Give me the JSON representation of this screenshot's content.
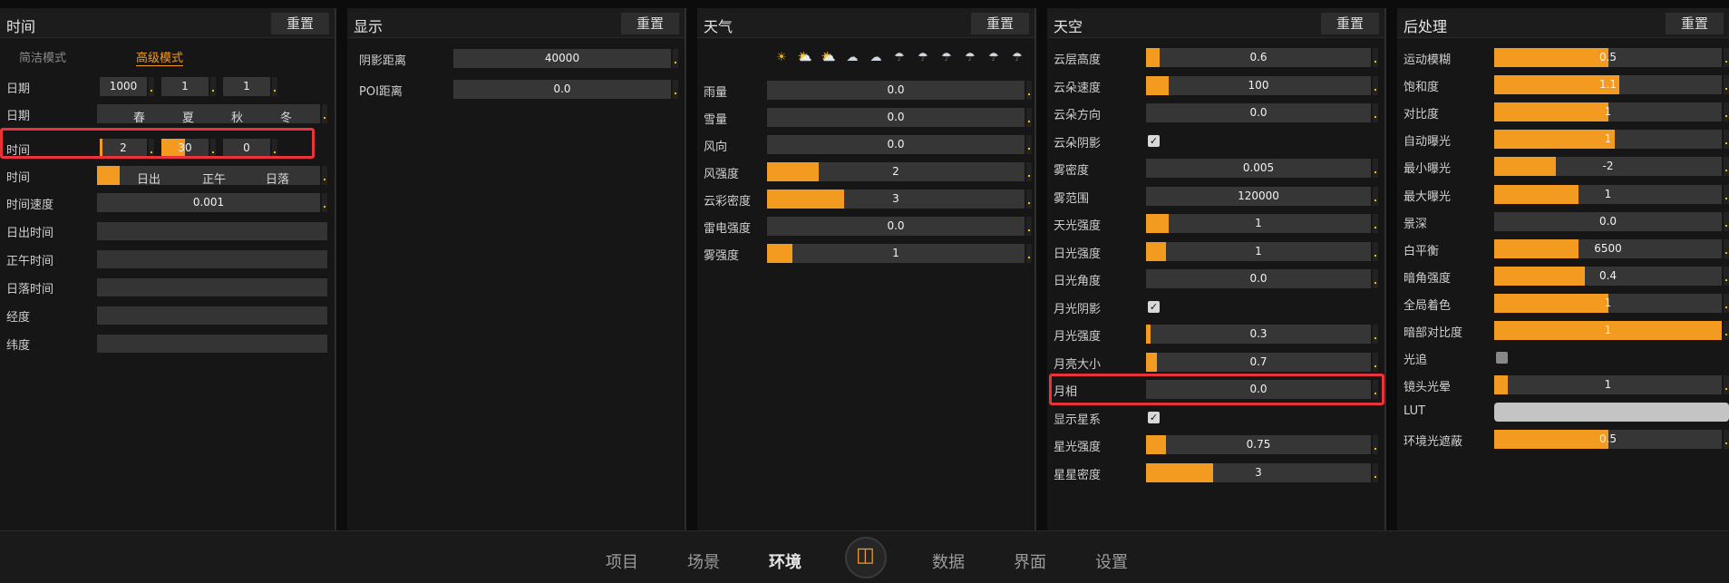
{
  "reset_label": "重置",
  "time_panel": {
    "title": "时间",
    "mode_simple": "简洁模式",
    "mode_advanced": "高级模式",
    "date_label": "日期",
    "date_year": "1000",
    "date_month": "1",
    "date_day": "1",
    "season_label": "日期",
    "seasons": [
      "春",
      "夏",
      "秋",
      "冬"
    ],
    "time_label": "时间",
    "time_hour": "2",
    "time_minute": "30",
    "time_second": "0",
    "time_fill_hour": 0.05,
    "time_fill_minute": 0.5,
    "preset_label": "时间",
    "presets": [
      "日出",
      "正午",
      "日落"
    ],
    "speed_label": "时间速度",
    "speed_value": "0.001",
    "sunrise_label": "日出时间",
    "noon_label": "正午时间",
    "sunset_label": "日落时间",
    "longitude_label": "经度",
    "latitude_label": "纬度"
  },
  "display_panel": {
    "title": "显示",
    "shadow_label": "阴影距离",
    "shadow_value": "40000",
    "poi_label": "POI距离",
    "poi_value": "0.0"
  },
  "weather_panel": {
    "title": "天气",
    "icons": [
      "☀",
      "⛅",
      "⛅",
      "☁",
      "☁",
      "☂",
      "☂",
      "☂",
      "☂",
      "☂",
      "☂"
    ],
    "rows": [
      {
        "label": "雨量",
        "value": "0.0",
        "fill": 0
      },
      {
        "label": "雪量",
        "value": "0.0",
        "fill": 0
      },
      {
        "label": "风向",
        "value": "0.0",
        "fill": 0
      },
      {
        "label": "风强度",
        "value": "2",
        "fill": 0.2
      },
      {
        "label": "云彩密度",
        "value": "3",
        "fill": 0.3
      },
      {
        "label": "雷电强度",
        "value": "0.0",
        "fill": 0
      },
      {
        "label": "雾强度",
        "value": "1",
        "fill": 0.1
      }
    ]
  },
  "sky_panel": {
    "title": "天空",
    "rows": [
      {
        "label": "云层高度",
        "type": "bar",
        "value": "0.6",
        "fill": 0.06
      },
      {
        "label": "云朵速度",
        "type": "bar",
        "value": "100",
        "fill": 0.1
      },
      {
        "label": "云朵方向",
        "type": "bar",
        "value": "0.0",
        "fill": 0
      },
      {
        "label": "云朵阴影",
        "type": "check",
        "checked": true
      },
      {
        "label": "雾密度",
        "type": "bar",
        "value": "0.005",
        "fill": 0
      },
      {
        "label": "雾范围",
        "type": "bar",
        "value": "120000",
        "fill": 0
      },
      {
        "label": "天光强度",
        "type": "bar",
        "value": "1",
        "fill": 0.1
      },
      {
        "label": "日光强度",
        "type": "bar",
        "value": "1",
        "fill": 0.09
      },
      {
        "label": "日光角度",
        "type": "bar",
        "value": "0.0",
        "fill": 0
      },
      {
        "label": "月光阴影",
        "type": "check",
        "checked": true
      },
      {
        "label": "月光强度",
        "type": "bar",
        "value": "0.3",
        "fill": 0.02
      },
      {
        "label": "月亮大小",
        "type": "bar",
        "value": "0.7",
        "fill": 0.05
      },
      {
        "label": "月相",
        "type": "bar",
        "value": "0.0",
        "fill": 0
      },
      {
        "label": "显示星系",
        "type": "check",
        "checked": true
      },
      {
        "label": "星光强度",
        "type": "bar",
        "value": "0.75",
        "fill": 0.09
      },
      {
        "label": "星星密度",
        "type": "bar",
        "value": "3",
        "fill": 0.3
      }
    ]
  },
  "post_panel": {
    "title": "后处理",
    "rows": [
      {
        "label": "运动模糊",
        "type": "bar",
        "value": "0.5",
        "fill": 0.5
      },
      {
        "label": "饱和度",
        "type": "bar",
        "value": "1.1",
        "fill": 0.55
      },
      {
        "label": "对比度",
        "type": "bar",
        "value": "1",
        "fill": 0.5
      },
      {
        "label": "自动曝光",
        "type": "bar",
        "value": "1",
        "fill": 0.53
      },
      {
        "label": "最小曝光",
        "type": "bar",
        "value": "-2",
        "fill": 0.27
      },
      {
        "label": "最大曝光",
        "type": "bar",
        "value": "1",
        "fill": 0.37
      },
      {
        "label": "景深",
        "type": "bar",
        "value": "0.0",
        "fill": 0
      },
      {
        "label": "白平衡",
        "type": "bar",
        "value": "6500",
        "fill": 0.37
      },
      {
        "label": "暗角强度",
        "type": "bar",
        "value": "0.4",
        "fill": 0.4
      },
      {
        "label": "全局着色",
        "type": "bar",
        "value": "1",
        "fill": 0.5
      },
      {
        "label": "暗部对比度",
        "type": "bar",
        "value": "1",
        "fill": 1.0
      },
      {
        "label": "光追",
        "type": "check",
        "checked": false
      },
      {
        "label": "镜头光晕",
        "type": "bar",
        "value": "1",
        "fill": 0.06
      },
      {
        "label": "LUT",
        "type": "lut"
      },
      {
        "label": "环境光遮蔽",
        "type": "bar",
        "value": "0.5",
        "fill": 0.5
      }
    ]
  },
  "nav": {
    "items": [
      "项目",
      "场景",
      "环境",
      "数据",
      "界面",
      "设置"
    ],
    "active": "环境"
  }
}
